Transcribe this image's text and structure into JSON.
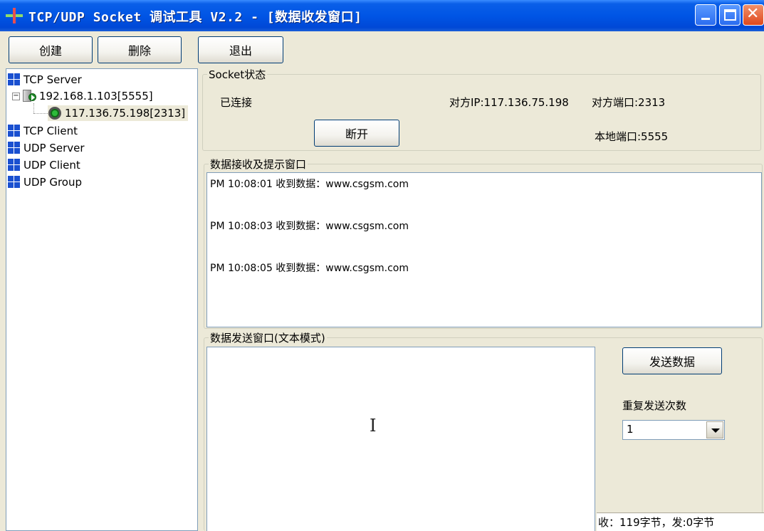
{
  "window": {
    "title": "TCP/UDP Socket 调试工具 V2.2 - [数据收发窗口]"
  },
  "toolbar": {
    "create_label": "创建",
    "delete_label": "删除",
    "exit_label": "退出"
  },
  "tree": {
    "tcp_server": "TCP Server",
    "server_node": "192.168.1.103[5555]",
    "client_node": "117.136.75.198[2313]",
    "tcp_client": "TCP Client",
    "udp_server": "UDP Server",
    "udp_client": "UDP Client",
    "udp_group": "UDP Group"
  },
  "socket_status": {
    "group_title": "Socket状态",
    "state": "已连接",
    "remote_ip": "对方IP:117.136.75.198",
    "remote_port": "对方端口:2313",
    "local_port": "本地端口:5555",
    "disconnect_label": "断开"
  },
  "receive": {
    "group_title": "数据接收及提示窗口",
    "lines": [
      "PM 10:08:01 收到数据：www.csgsm.com",
      "PM 10:08:03 收到数据：www.csgsm.com",
      "PM 10:08:05 收到数据：www.csgsm.com"
    ]
  },
  "send": {
    "group_title": "数据发送窗口(文本模式)",
    "send_button": "发送数据",
    "repeat_label": "重复发送次数",
    "repeat_value": "1"
  },
  "status": {
    "counts": "收：119字节，发:0字节"
  },
  "colors": {
    "titlebar": "#0055e5",
    "window_bg": "#ece9d8",
    "field_border": "#7f9db9"
  }
}
